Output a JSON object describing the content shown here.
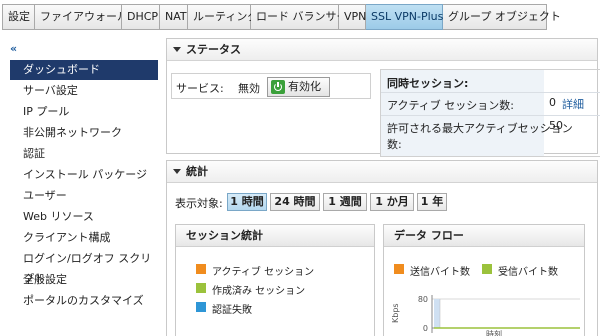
{
  "tabs": [
    {
      "label": "設定",
      "w": 33
    },
    {
      "label": "ファイアウォール",
      "w": 87
    },
    {
      "label": "DHCP",
      "w": 38
    },
    {
      "label": "NAT",
      "w": 28
    },
    {
      "label": "ルーティング",
      "w": 63
    },
    {
      "label": "ロード バランサー",
      "w": 88
    },
    {
      "label": "VPN",
      "w": 27
    },
    {
      "label": "SSL VPN-Plus",
      "w": 77
    },
    {
      "label": "グループ オブジェクト",
      "w": 104
    }
  ],
  "active_tab": "SSL VPN-Plus",
  "sidebar": {
    "collapse_glyph": "«",
    "items": [
      "ダッシュボード",
      "サーバ設定",
      "IP プール",
      "非公開ネットワーク",
      "認証",
      "インストール パッケージ",
      "ユーザー",
      "Web リソース",
      "クライアント構成",
      "ログイン/ログオフ スクリプト",
      "全般設定",
      "ポータルのカスタマイズ"
    ],
    "active_index": 0
  },
  "status": {
    "title": "ステータス",
    "service_label": "サービス:",
    "service_value": "無効",
    "enable_button": "有効化",
    "concurrent_title": "同時セッション:",
    "active_label": "アクティブ セッション数:",
    "active_value": "0",
    "details_link": "詳細",
    "max_label_1": "許可される最大アクティブセッション",
    "max_label_2": "数:",
    "max_value": "50"
  },
  "stats": {
    "title": "統計",
    "display_label": "表示対象:",
    "ranges": [
      "1 時間",
      "24 時間",
      "1 週間",
      "1 か月",
      "1 年"
    ],
    "active_range": 0,
    "session_stats": {
      "title": "セッション統計",
      "legend": [
        {
          "label": "アクティブ セッション",
          "color": "#f08c1e"
        },
        {
          "label": "作成済み セッション",
          "color": "#9bc23c"
        },
        {
          "label": "認証失敗",
          "color": "#2e96d6"
        }
      ]
    },
    "data_flow": {
      "title": "データ フロー",
      "legend": [
        {
          "label": "送信バイト数",
          "color": "#f08c1e"
        },
        {
          "label": "受信バイト数",
          "color": "#9bc23c"
        }
      ],
      "y_axis_label": "Kbps",
      "y_ticks": [
        "80",
        "0"
      ],
      "x_axis_label": "時刻"
    }
  }
}
